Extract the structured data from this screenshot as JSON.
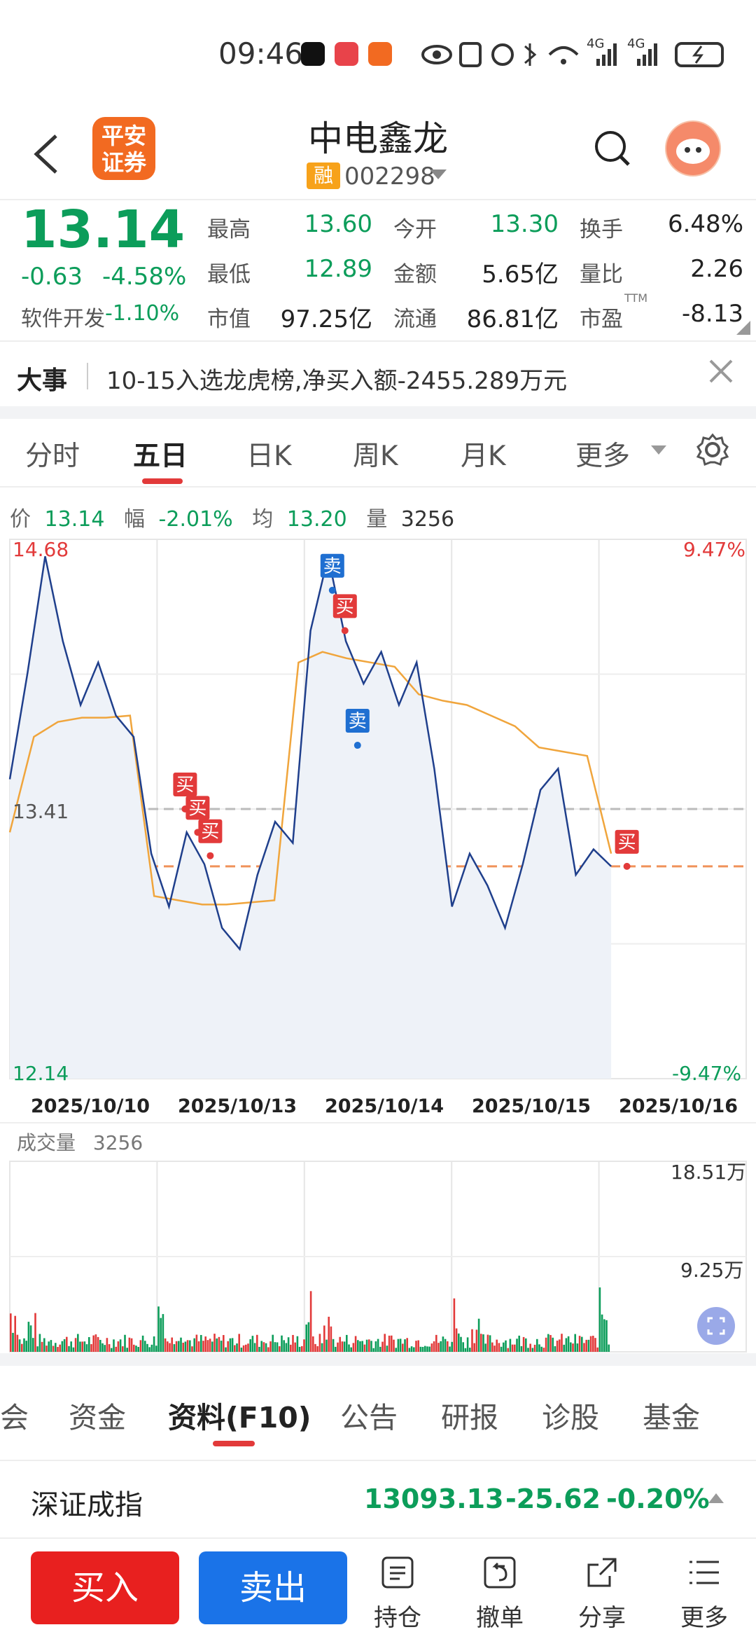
{
  "status_bar": {
    "time": "09:46",
    "network1": "4G",
    "network2": "4G"
  },
  "header": {
    "broker_logo": "平安\n证券",
    "stock_name": "中电鑫龙",
    "badge": "融",
    "stock_code": "002298"
  },
  "quote": {
    "price": "13.14",
    "change": "-0.63",
    "change_pct": "-4.58%",
    "sector_name": "软件开发",
    "sector_pct": "-1.10%",
    "labels": {
      "high": "最高",
      "low": "最低",
      "mktcap": "市值",
      "open": "今开",
      "amount": "金额",
      "float": "流通",
      "turnover": "换手",
      "vol_ratio": "量比",
      "pe": "市盈"
    },
    "high": "13.60",
    "low": "12.89",
    "mktcap": "97.25亿",
    "open": "13.30",
    "amount": "5.65亿",
    "float": "86.81亿",
    "turnover": "6.48%",
    "vol_ratio": "2.26",
    "pe": "-8.13",
    "pe_sup": "TTM"
  },
  "news": {
    "tag": "大事",
    "text": "10-15入选龙虎榜,净买入额-2455.289万元"
  },
  "chart_tabs": [
    "分时",
    "五日",
    "日K",
    "周K",
    "月K",
    "更多"
  ],
  "chart_info": {
    "price_label": "价",
    "price": "13.14",
    "amp_label": "幅",
    "amp": "-2.01%",
    "avg_label": "均",
    "avg": "13.20",
    "vol_label": "量",
    "vol": "3256"
  },
  "colors": {
    "up": "#e23a3a",
    "down": "#0c9d5a",
    "price_line": "#1f3f8c",
    "avg_line": "#f0a53c",
    "buy_badge": "#e23a3a",
    "sell_badge": "#1f6fd1"
  },
  "chart_data": {
    "type": "line",
    "x": [
      "2025/10/10",
      "2025/10/13",
      "2025/10/14",
      "2025/10/15",
      "2025/10/16"
    ],
    "y_top_label": "14.68",
    "y_mid_label": "13.41",
    "y_bottom_label": "12.14",
    "pct_top_label": "9.47%",
    "pct_bottom_label": "-9.47%",
    "ylim": [
      12.14,
      14.68
    ],
    "prev_close": 13.41,
    "current_price": 13.14,
    "series": [
      {
        "values": [
          13.55,
          14.05,
          14.6,
          14.2,
          13.9,
          14.1,
          13.85,
          13.75,
          13.2,
          12.95,
          13.3,
          13.15,
          12.85,
          12.75,
          13.1,
          13.35,
          13.25,
          14.25,
          14.6,
          14.2,
          14.0,
          14.15,
          13.9,
          14.1,
          13.6,
          12.95,
          13.2,
          13.05,
          12.85,
          13.15,
          13.5,
          13.6,
          13.1,
          13.22,
          13.14
        ]
      },
      {
        "values": [
          13.3,
          13.75,
          13.82,
          13.84,
          13.84,
          13.85,
          13.0,
          12.98,
          12.96,
          12.96,
          12.97,
          12.98,
          14.1,
          14.15,
          14.12,
          14.1,
          14.08,
          13.95,
          13.92,
          13.9,
          13.85,
          13.8,
          13.7,
          13.68,
          13.66,
          13.2
        ]
      }
    ],
    "markers": [
      {
        "label": "买",
        "date_index": 1,
        "value": 13.41
      },
      {
        "label": "买",
        "date_index": 1,
        "value": 13.3
      },
      {
        "label": "买",
        "date_index": 1,
        "value": 13.19
      },
      {
        "label": "卖",
        "date_index": 2,
        "value": 14.44
      },
      {
        "label": "买",
        "date_index": 2,
        "value": 14.25
      },
      {
        "label": "卖",
        "date_index": 2,
        "value": 13.71
      },
      {
        "label": "买",
        "date_index": 4,
        "value": 13.14
      }
    ],
    "volume": {
      "label": "成交量",
      "value": "3256",
      "max_label": "18.51万",
      "mid_label": "9.25万",
      "ylim": [
        0,
        18.51
      ]
    }
  },
  "bottom_tabs": [
    "会",
    "资金",
    "资料(F10)",
    "公告",
    "研报",
    "诊股",
    "基金"
  ],
  "index": {
    "name": "深证成指",
    "value": "13093.13",
    "change": "-25.62",
    "pct": "-0.20%"
  },
  "footer": {
    "buy": "买入",
    "sell": "卖出",
    "tools": [
      "持仓",
      "撤单",
      "分享",
      "更多"
    ]
  }
}
